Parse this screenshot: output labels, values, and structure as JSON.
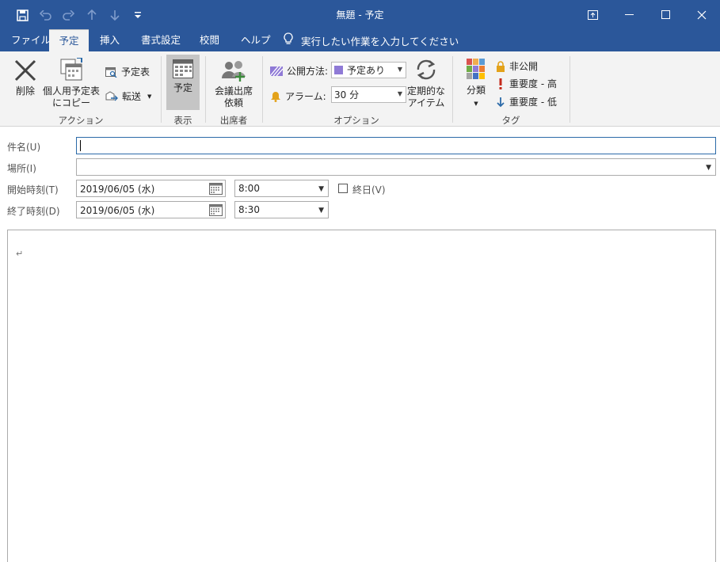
{
  "window": {
    "title": "無題 - 予定",
    "qat_icons": [
      "save-icon",
      "undo-icon",
      "redo-icon",
      "up-arrow-icon",
      "down-arrow-icon",
      "customize-icon"
    ],
    "controls": [
      "ribbon-display-icon",
      "minimize-icon",
      "maximize-icon",
      "close-icon"
    ]
  },
  "menu": {
    "tabs": [
      "ファイル",
      "予定",
      "挿入",
      "書式設定",
      "校閲",
      "ヘルプ"
    ],
    "active_tab": "予定",
    "tell_me": "実行したい作業を入力してください"
  },
  "ribbon": {
    "groups": {
      "actions": "アクション",
      "show": "表示",
      "attendees": "出席者",
      "options": "オプション",
      "tags": "タグ"
    },
    "delete_label": "削除",
    "copy_label_1": "個人用予定表",
    "copy_label_2": "にコピー",
    "calendar_label": "予定表",
    "forward_label": "転送",
    "appointment_label": "予定",
    "meeting_label_1": "会議出席",
    "meeting_label_2": "依頼",
    "show_as_label": "公開方法:",
    "show_as_value": "予定あり",
    "reminder_label": "アラーム:",
    "reminder_value": "30 分",
    "recurrence_label_1": "定期的な",
    "recurrence_label_2": "アイテム",
    "categorize_label": "分類",
    "private_label": "非公開",
    "high_importance_label": "重要度 - 高",
    "low_importance_label": "重要度 - 低",
    "colors": {
      "accent": "#2b579a",
      "busy": "#8f7ad6",
      "high": "#c42b1c",
      "low": "#2b6aa8",
      "private": "#e3a21a"
    }
  },
  "form": {
    "subject_label": "件名(U)",
    "subject_value": "",
    "location_label": "場所(I)",
    "location_value": "",
    "start_label": "開始時刻(T)",
    "start_date": "2019/06/05 (水)",
    "start_time": "8:00",
    "all_day_label": "終日(V)",
    "end_label": "終了時刻(D)",
    "end_date": "2019/06/05 (水)",
    "end_time": "8:30",
    "body_mark": "↵"
  }
}
